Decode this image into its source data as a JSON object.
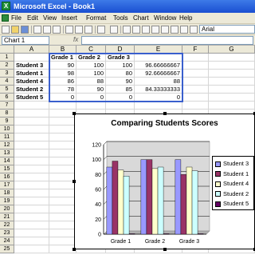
{
  "window": {
    "title": "Microsoft Excel - Book1",
    "app_icon": "X"
  },
  "menu": [
    "File",
    "Edit",
    "View",
    "Insert",
    "Format",
    "Tools",
    "Chart",
    "Window",
    "Help"
  ],
  "toolbar": {
    "font": "Arial"
  },
  "formula_bar": {
    "name_box": "Chart 1",
    "fx": "fx",
    "formula": ""
  },
  "sheet": {
    "columns": [
      "A",
      "B",
      "C",
      "D",
      "E",
      "F",
      "G"
    ],
    "rows": [
      "1",
      "2",
      "3",
      "4",
      "5",
      "6",
      "7",
      "8",
      "9",
      "10",
      "11",
      "12",
      "13",
      "14",
      "15",
      "16",
      "17",
      "18",
      "19",
      "20",
      "21",
      "22",
      "23",
      "24",
      "25"
    ],
    "header": [
      "",
      "Grade 1",
      "Grade 2",
      "Grade 3",
      ""
    ],
    "data": [
      [
        "Student 3",
        "90",
        "100",
        "100",
        "96.66666667"
      ],
      [
        "Student 1",
        "98",
        "100",
        "80",
        "92.66666667"
      ],
      [
        "Student 4",
        "86",
        "88",
        "90",
        "88"
      ],
      [
        "Student 2",
        "78",
        "90",
        "85",
        "84.33333333"
      ],
      [
        "Student 5",
        "0",
        "0",
        "0",
        "0"
      ]
    ]
  },
  "chart_data": {
    "type": "bar",
    "title": "Comparing Students Scores",
    "categories": [
      "Grade 1",
      "Grade 2",
      "Grade 3"
    ],
    "ylim": [
      0,
      120
    ],
    "yticks": [
      0,
      20,
      40,
      60,
      80,
      100,
      120
    ],
    "grid": true,
    "legend_position": "right",
    "series": [
      {
        "name": "Student 3",
        "values": [
          90,
          100,
          100
        ],
        "color": "#9999ff"
      },
      {
        "name": "Student 1",
        "values": [
          98,
          100,
          80
        ],
        "color": "#993366"
      },
      {
        "name": "Student 4",
        "values": [
          86,
          88,
          90
        ],
        "color": "#ffffcc"
      },
      {
        "name": "Student 2",
        "values": [
          78,
          90,
          85
        ],
        "color": "#ccffff"
      },
      {
        "name": "Student 5",
        "values": [
          0,
          0,
          0
        ],
        "color": "#660066"
      }
    ]
  }
}
